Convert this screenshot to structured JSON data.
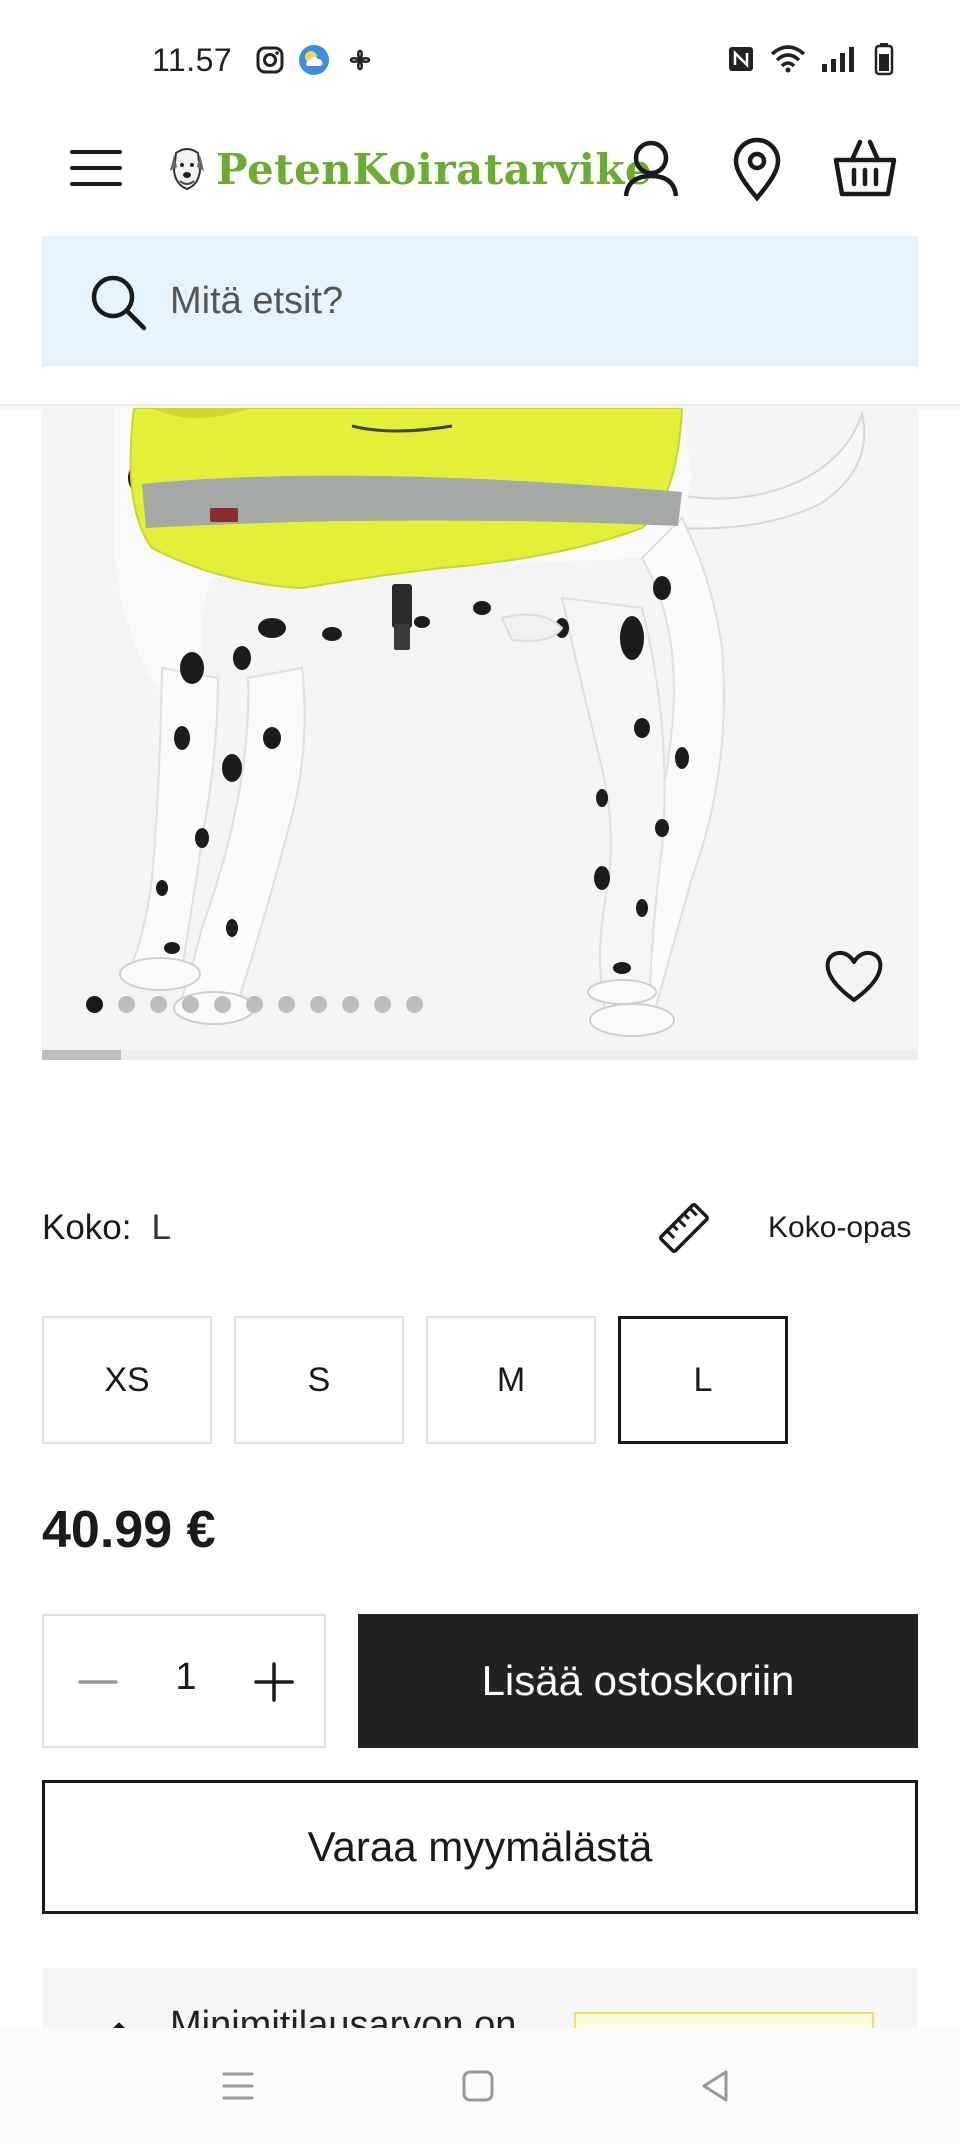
{
  "status_bar": {
    "time": "11.57"
  },
  "header": {
    "logo_text": "PetenKoiratarvike"
  },
  "search": {
    "placeholder": "Mitä etsit?"
  },
  "gallery": {
    "image_count": 11,
    "active_index": 0,
    "progress": 0.09
  },
  "product": {
    "size_label": "Koko:",
    "size_value": "L",
    "size_guide_label": "Koko-opas",
    "size_options": [
      "XS",
      "S",
      "M",
      "L"
    ],
    "selected_size": "L",
    "price": "40.99 €"
  },
  "purchase": {
    "quantity": "1",
    "add_to_cart_label": "Lisää ostoskoriin",
    "reserve_label": "Varaa myymälästä"
  },
  "min_order": {
    "text": "Minimitilausarvon on"
  },
  "colors": {
    "brand": "#6aad2f",
    "search_bg": "#e6f3fc",
    "primary_button": "#222222",
    "vest": "#e2f03a"
  }
}
